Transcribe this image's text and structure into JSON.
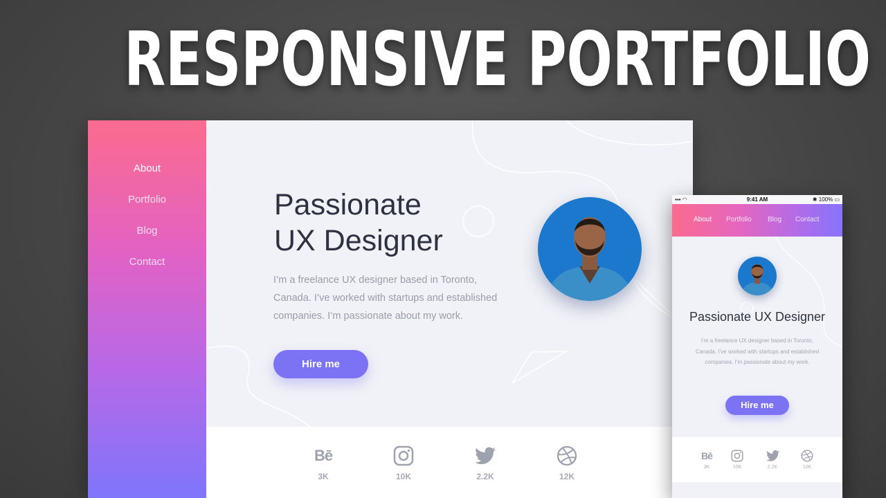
{
  "banner": {
    "title": "RESPONSIVE PORTFOLIO"
  },
  "desktop": {
    "nav": [
      {
        "label": "About",
        "active": true
      },
      {
        "label": "Portfolio",
        "active": false
      },
      {
        "label": "Blog",
        "active": false
      },
      {
        "label": "Contact",
        "active": false
      }
    ],
    "hero": {
      "title_line1": "Passionate",
      "title_line2": "UX Designer",
      "description": "I’m a freelance UX designer based in Toronto, Canada. I’ve worked with startups and established companies. I’m passionate about my work.",
      "button_label": "Hire me"
    },
    "social": [
      {
        "icon": "behance-icon",
        "count": "3K"
      },
      {
        "icon": "instagram-icon",
        "count": "10K"
      },
      {
        "icon": "twitter-icon",
        "count": "2.2K"
      },
      {
        "icon": "dribbble-icon",
        "count": "12K"
      }
    ]
  },
  "mobile": {
    "status": {
      "time": "9:41 AM",
      "battery": "100%"
    },
    "nav": [
      {
        "label": "About",
        "active": true
      },
      {
        "label": "Portfolio",
        "active": false
      },
      {
        "label": "Blog",
        "active": false
      },
      {
        "label": "Contact",
        "active": false
      }
    ],
    "hero": {
      "title": "Passionate UX Designer",
      "description": "I’m a freelance UX designer based in Toronto, Canada. I’ve worked with startups and established companies. I’m passionate about my work.",
      "button_label": "Hire me"
    },
    "social": [
      {
        "icon": "behance-icon",
        "count": "3K"
      },
      {
        "icon": "instagram-icon",
        "count": "10K"
      },
      {
        "icon": "twitter-icon",
        "count": "2.2K"
      },
      {
        "icon": "dribbble-icon",
        "count": "12K"
      }
    ]
  },
  "colors": {
    "accent": "#7c72f4",
    "gradient_top": "#fb6b8e",
    "gradient_bottom": "#7f75fb",
    "heading": "#2f3142",
    "muted": "#9a9cab"
  }
}
